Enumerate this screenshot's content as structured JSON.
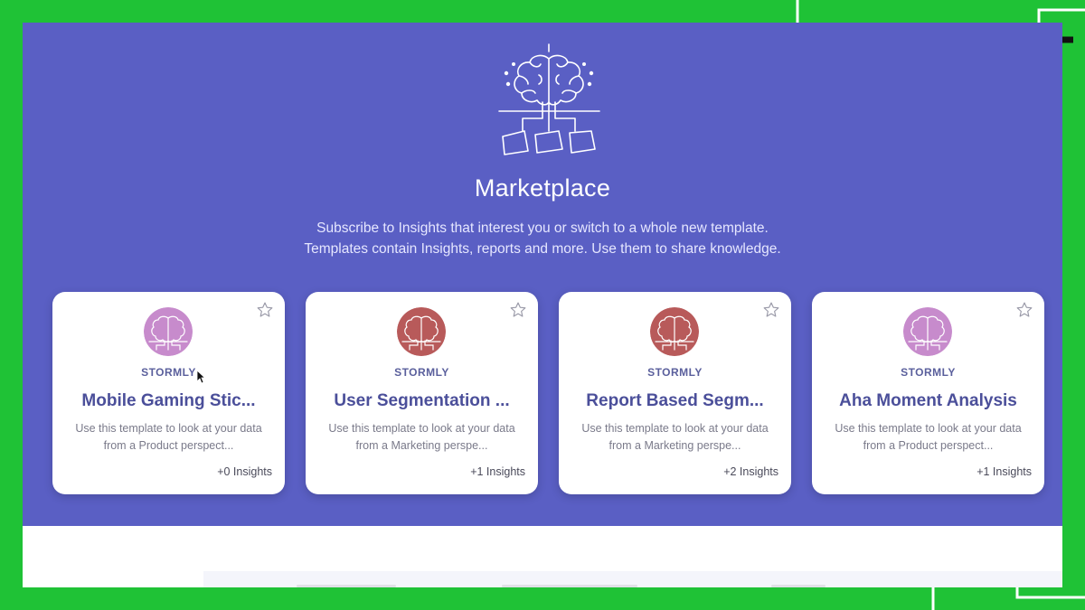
{
  "marketplace": {
    "title": "Marketplace",
    "subtitle_line1": "Subscribe to Insights that interest you or switch to a whole new template.",
    "subtitle_line2": "Templates contain Insights, reports and more. Use them to share knowledge."
  },
  "cards": [
    {
      "vendor": "STORMLY",
      "name": "Mobile Gaming Stic...",
      "desc_line1": "Use this template to look at your data",
      "desc_line2": "from a Product perspect...",
      "insights": "+0 Insights",
      "avatar_color": "#c78bcc"
    },
    {
      "vendor": "STORMLY",
      "name": "User Segmentation ...",
      "desc_line1": "Use this template to look at your data",
      "desc_line2": "from a Marketing perspe...",
      "insights": "+1 Insights",
      "avatar_color": "#b85a5a"
    },
    {
      "vendor": "STORMLY",
      "name": "Report Based Segm...",
      "desc_line1": "Use this template to look at your data",
      "desc_line2": "from a Marketing perspe...",
      "insights": "+2 Insights",
      "avatar_color": "#b85a5a"
    },
    {
      "vendor": "STORMLY",
      "name": "Aha Moment Analysis",
      "desc_line1": "Use this template to look at your data",
      "desc_line2": "from a Product perspect...",
      "insights": "+1 Insights",
      "avatar_color": "#c78bcc"
    }
  ],
  "colors": {
    "hero_bg": "#5a5fc4",
    "frame_green": "#1fc236",
    "card_title": "#4b4f9a"
  },
  "icons": {
    "hero": "brain-network-icon",
    "card_avatar": "brain-avatar-icon",
    "favorite": "star-outline-icon",
    "pointer": "mouse-cursor-icon"
  }
}
